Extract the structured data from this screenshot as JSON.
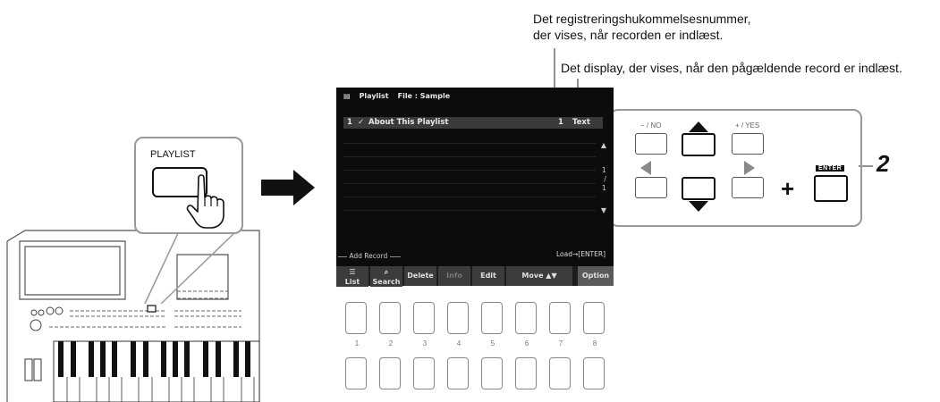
{
  "callouts": {
    "record_number": [
      "Det registreringshukommelsesnummer,",
      "der vises, når recorden er indlæst."
    ],
    "display_text": "Det display, der vises, når den pågældende record er indlæst.",
    "step_number": "2"
  },
  "panel": {
    "playlist_button_label": "PLAYLIST"
  },
  "screen": {
    "title": "Playlist",
    "file_label": "File : Sample",
    "record": {
      "index": "1",
      "check": "✓",
      "name": "About This Playlist",
      "regist_number": "1",
      "display": "Text"
    },
    "page_indicator": {
      "current": "1",
      "separator": "/",
      "total": "1"
    },
    "add_record_label": "Add Record",
    "load_hint": "Load→[ENTER]",
    "buttons": [
      {
        "label": "List"
      },
      {
        "label": "Search"
      },
      {
        "label": "Delete"
      },
      {
        "label": "Info"
      },
      {
        "label": "Edit"
      },
      {
        "label": "Move ▲▼"
      },
      {
        "label": ""
      },
      {
        "label": "Option"
      }
    ]
  },
  "controls": {
    "no_label": "− / NO",
    "yes_label": "+ / YES",
    "enter_label": "ENTER",
    "plus_sign": "+"
  },
  "number_buttons": [
    "1",
    "2",
    "3",
    "4",
    "5",
    "6",
    "7",
    "8"
  ]
}
